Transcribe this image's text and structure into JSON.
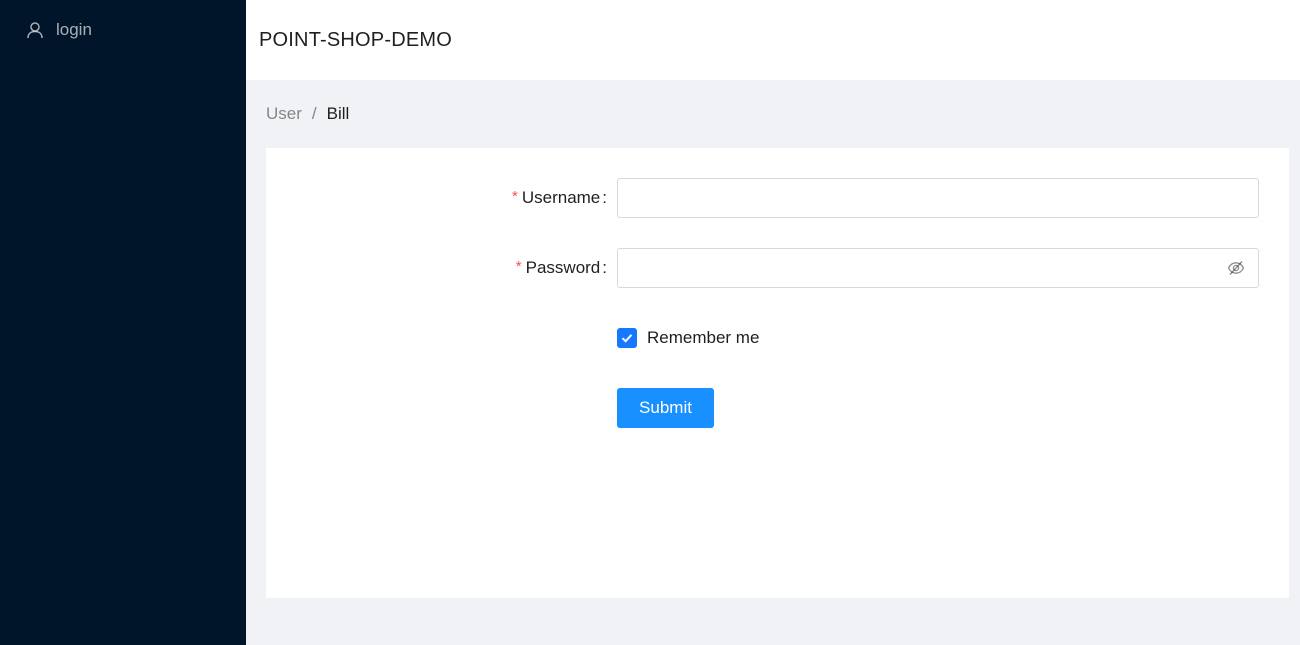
{
  "sidebar": {
    "items": [
      {
        "label": "login",
        "icon": "user-icon"
      }
    ]
  },
  "header": {
    "title": "POINT-SHOP-DEMO"
  },
  "breadcrumb": {
    "items": [
      "User",
      "Bill"
    ],
    "separator": "/"
  },
  "form": {
    "username": {
      "label": "Username",
      "colon": ":",
      "required_mark": "*",
      "value": "",
      "placeholder": ""
    },
    "password": {
      "label": "Password",
      "colon": ":",
      "required_mark": "*",
      "value": "",
      "placeholder": "",
      "toggle_icon": "eye-invisible-icon"
    },
    "remember": {
      "label": "Remember me",
      "checked": true
    },
    "submit_label": "Submit"
  },
  "colors": {
    "sider_bg": "#001529",
    "primary": "#1890ff",
    "required": "#ff4d4f",
    "content_bg": "#f0f2f5"
  }
}
